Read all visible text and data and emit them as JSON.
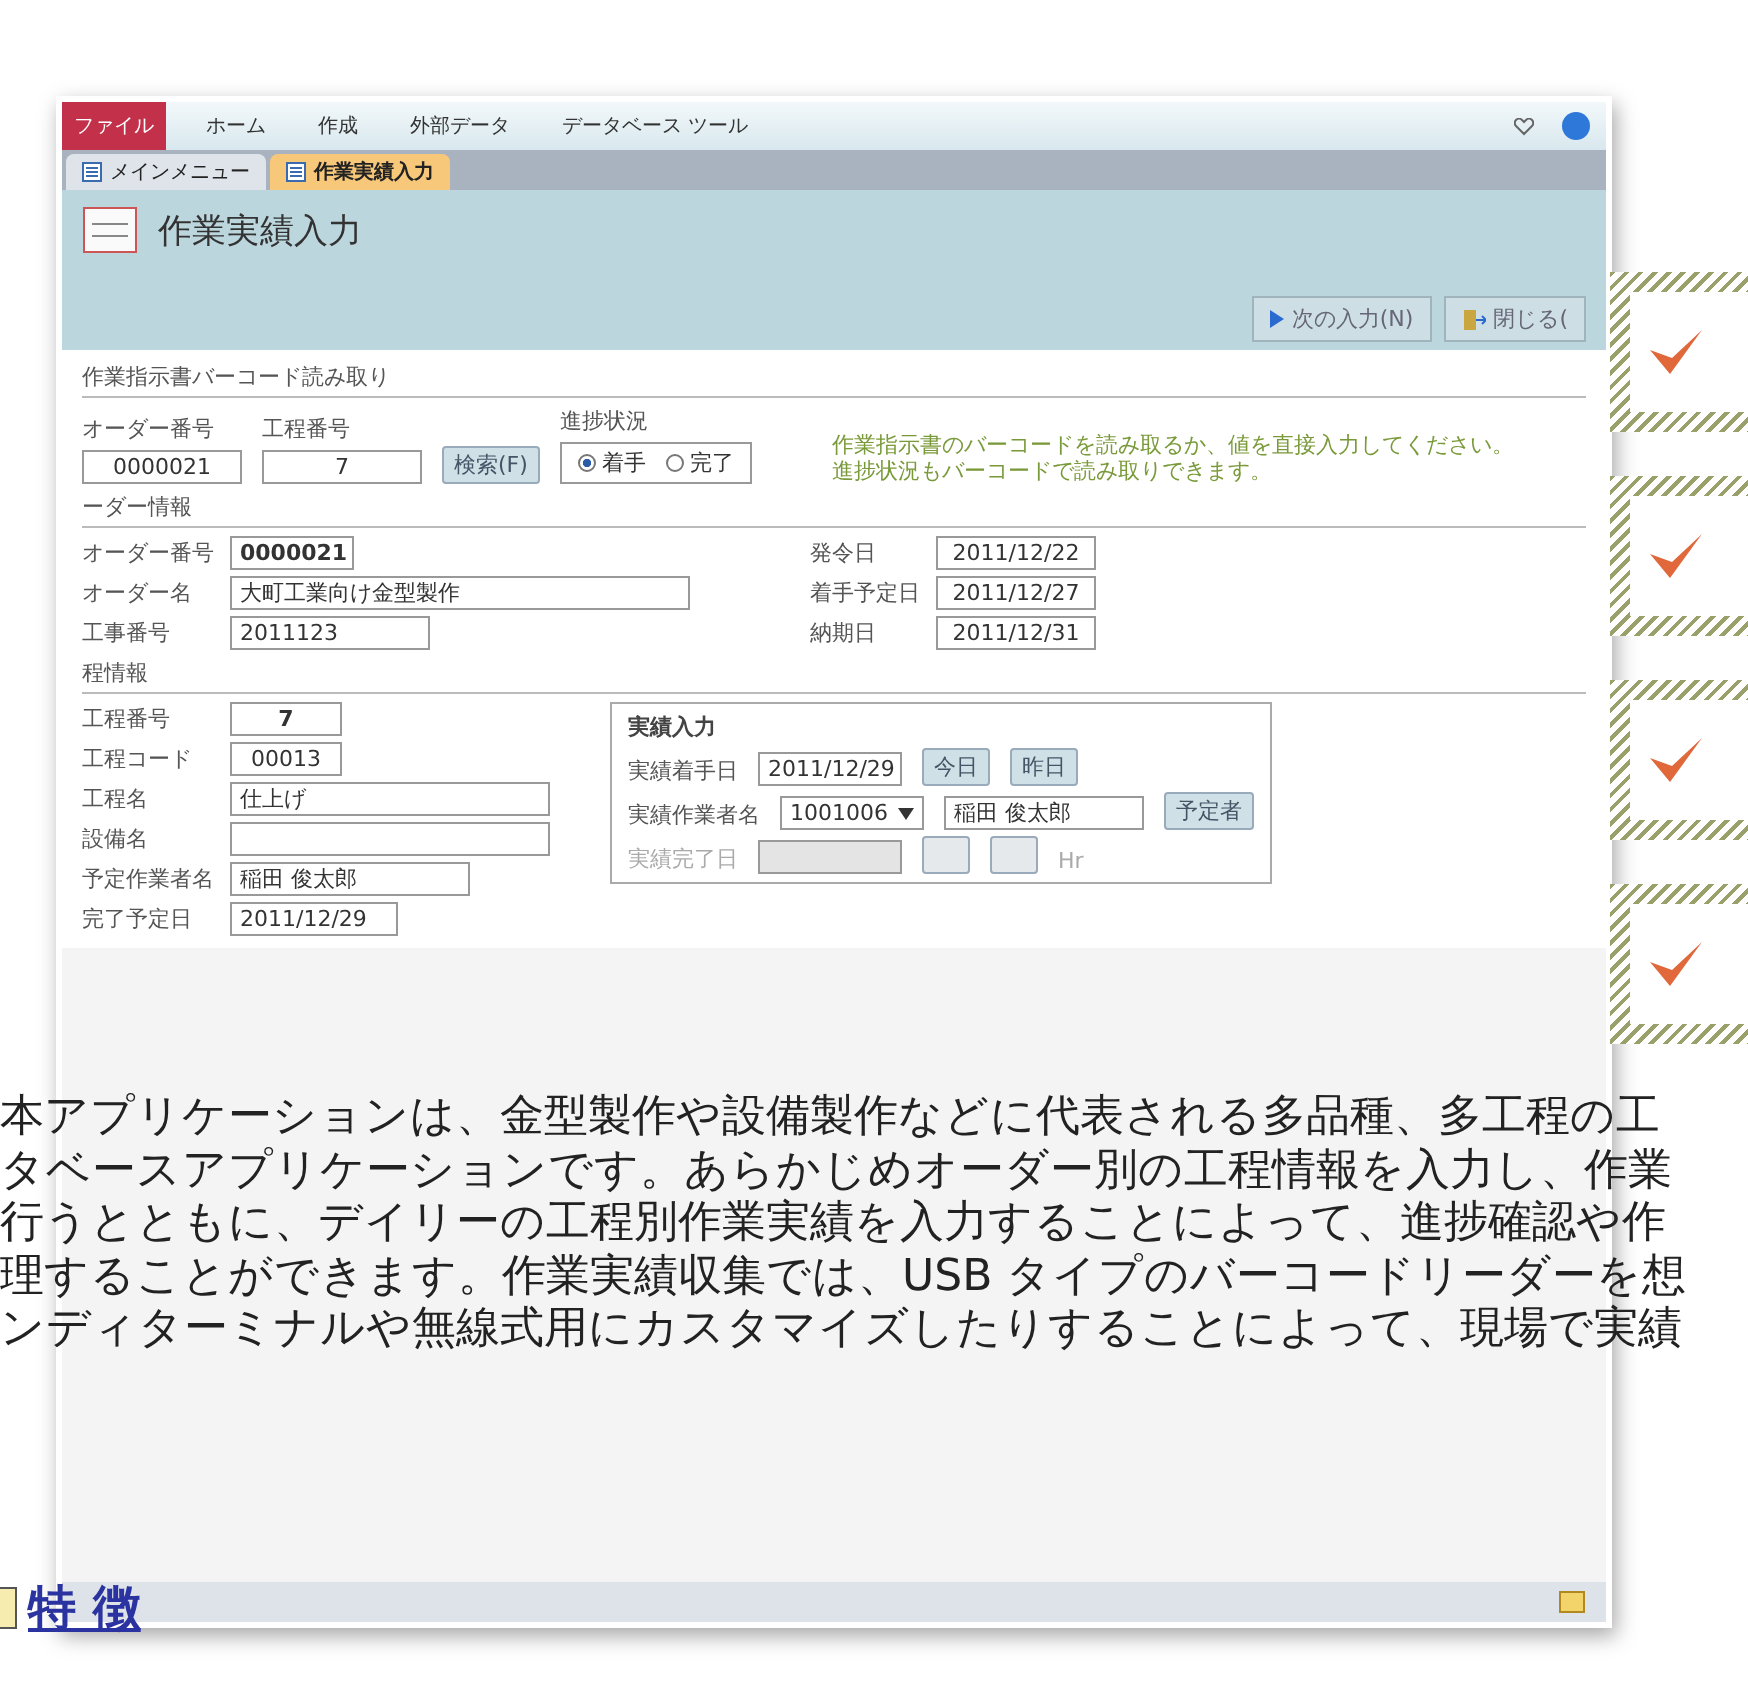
{
  "ribbon": {
    "tabs": [
      {
        "label": "ファイル",
        "selected": true
      },
      {
        "label": "ホーム",
        "selected": false
      },
      {
        "label": "作成",
        "selected": false
      },
      {
        "label": "外部データ",
        "selected": false
      },
      {
        "label": "データベース ツール",
        "selected": false
      }
    ]
  },
  "document_tabs": [
    {
      "label": "メインメニュー",
      "selected": false
    },
    {
      "label": "作業実績入力",
      "selected": true
    }
  ],
  "form": {
    "title": "作業実績入力",
    "buttons": [
      {
        "kind": "next",
        "label": "次の入力(N)"
      },
      {
        "kind": "close",
        "label": "閉じる("
      }
    ]
  },
  "barcode_section": {
    "title": "作業指示書バーコード読み取り",
    "fields": [
      {
        "label": "オーダー番号",
        "value": "0000021"
      },
      {
        "label": "工程番号",
        "value": "7"
      }
    ],
    "search_button": "検索(F)",
    "progress": {
      "label": "進捗状況",
      "options": [
        {
          "label": "着手",
          "selected": true
        },
        {
          "label": "完了",
          "selected": false
        }
      ]
    },
    "instructions": [
      "作業指示書のバーコードを読み取るか、値を直接入力してください。",
      "進捗状況もバーコードで読み取りできます。"
    ]
  },
  "order_section": {
    "title": "ーダー情報",
    "fields": [
      {
        "label": "オーダー番号",
        "value": "0000021",
        "emphasis": true
      },
      {
        "label": "オーダー名",
        "value": "大町工業向け金型製作",
        "emphasis": false
      },
      {
        "label": "工事番号",
        "value": "2011123",
        "emphasis": false
      }
    ],
    "dates": [
      {
        "label": "発令日",
        "value": "2011/12/22"
      },
      {
        "label": "着手予定日",
        "value": "2011/12/27"
      },
      {
        "label": "納期日",
        "value": "2011/12/31"
      }
    ]
  },
  "process_section": {
    "title": "程情報",
    "fields": [
      {
        "label": "工程番号",
        "value": "7",
        "emphasis": true
      },
      {
        "label": "工程コード",
        "value": "00013",
        "emphasis": false
      },
      {
        "label": "工程名",
        "value": "仕上げ",
        "emphasis": false
      },
      {
        "label": "設備名"
      },
      {
        "label": "予定作業者名",
        "value": "稲田 俊太郎",
        "emphasis": false
      },
      {
        "label": "完了予定日",
        "value": "2011/12/29",
        "emphasis": false
      }
    ],
    "actual_entry": {
      "title": "実績入力",
      "start_date": {
        "label": "実績着手日",
        "value": "2011/12/29"
      },
      "date_buttons": [
        "今日",
        "昨日"
      ],
      "worker": {
        "label": "実績作業者名",
        "code": "1001006",
        "name": "稲田 俊太郎"
      },
      "planned_button": "予定者",
      "end_date": {
        "label": "実績完了日",
        "disabled": true
      },
      "unit": "Hr"
    }
  },
  "article": {
    "paragraph_lines": [
      "本アプリケーションは、金型製作や設備製作などに代表される多品種、多工程の工",
      "タベースアプリケーションです。あらかじめオーダー別の工程情報を入力し、作業",
      "行うとともに、デイリーの工程別作業実績を入力することによって、進捗確認や作",
      "理することができます。作業実績収集では、USB タイプのバーコードリーダーを想",
      "ンディターミナルや無線式用にカスタマイズしたりすることによって、現場で実績"
    ],
    "heading": "特 徴"
  }
}
